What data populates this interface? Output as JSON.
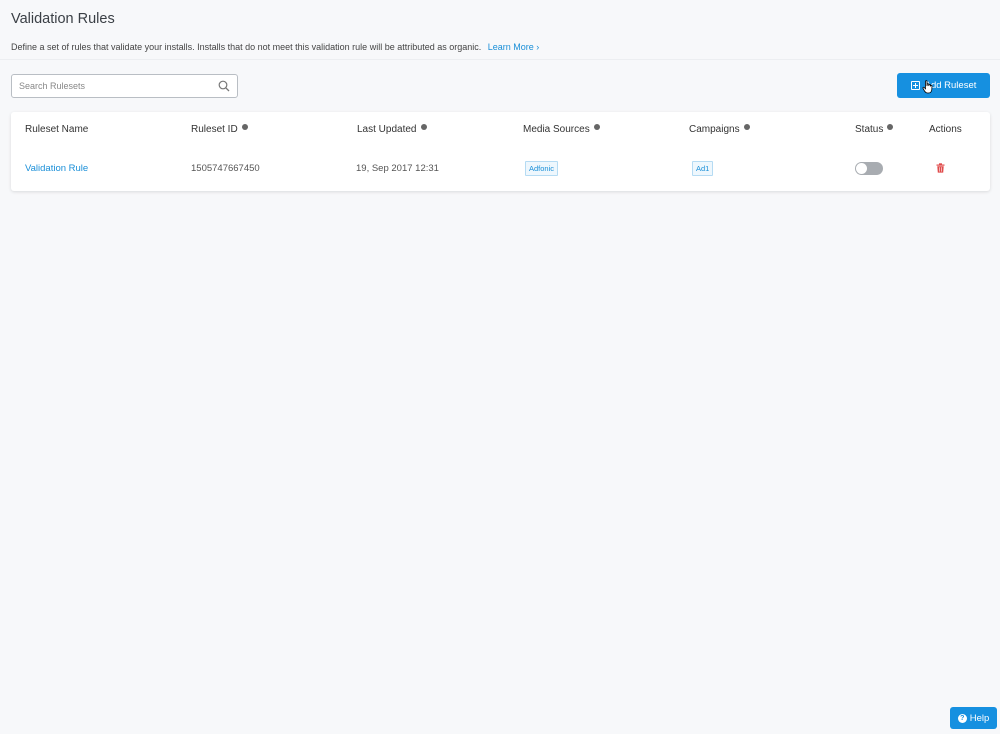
{
  "header": {
    "title": "Validation Rules",
    "description": "Define a set of rules that validate your installs. Installs that do not meet this validation rule will be attributed as organic.",
    "learn_more": "Learn More ›"
  },
  "search": {
    "placeholder": "Search Rulesets",
    "value": ""
  },
  "toolbar": {
    "add_label": "Add Ruleset"
  },
  "table": {
    "columns": [
      "Ruleset Name",
      "Ruleset ID",
      "Last Updated",
      "Media Sources",
      "Campaigns",
      "Status",
      "Actions"
    ],
    "rows": [
      {
        "name": "Validation Rule",
        "id": "1505747667450",
        "updated": "19, Sep 2017 12:31",
        "media_source": "Adfonic",
        "campaign": "Ad1",
        "status_on": false
      }
    ]
  },
  "help": {
    "label": "Help"
  },
  "colors": {
    "accent": "#1690e0",
    "link": "#1a8fd8",
    "danger": "#e04b4b"
  }
}
